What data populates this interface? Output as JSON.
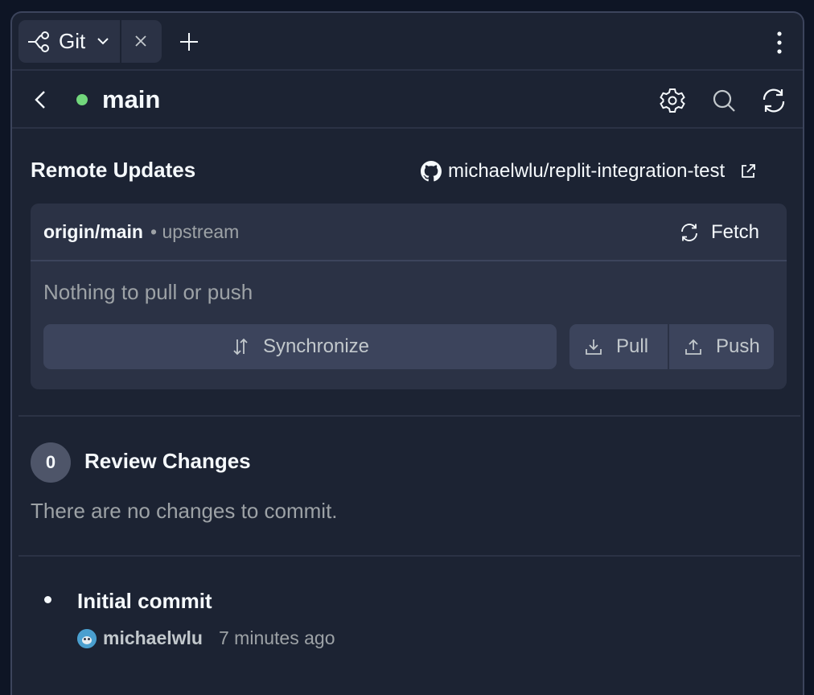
{
  "tab": {
    "label": "Git"
  },
  "branch": {
    "name": "main"
  },
  "remote": {
    "title": "Remote Updates",
    "repo": "michaelwlu/replit-integration-test",
    "origin": "origin/main",
    "upstream": "• upstream",
    "fetch_label": "Fetch",
    "status": "Nothing to pull or push",
    "sync_label": "Synchronize",
    "pull_label": "Pull",
    "push_label": "Push"
  },
  "review": {
    "count": "0",
    "title": "Review Changes",
    "empty": "There are no changes to commit."
  },
  "commit": {
    "message": "Initial commit",
    "author": "michaelwlu",
    "time": "7 minutes ago"
  },
  "colors": {
    "background": "#1c2333",
    "status_dot": "#72d77c",
    "card": "#2b3245",
    "button": "#3c445c"
  },
  "icons": [
    "git-branch-icon",
    "chevron-down-icon",
    "close-icon",
    "plus-icon",
    "kebab-menu-icon",
    "back-chevron-icon",
    "gear-icon",
    "search-icon",
    "refresh-icon",
    "github-icon",
    "external-link-icon",
    "fetch-icon",
    "synchronize-icon",
    "pull-icon",
    "push-icon"
  ]
}
